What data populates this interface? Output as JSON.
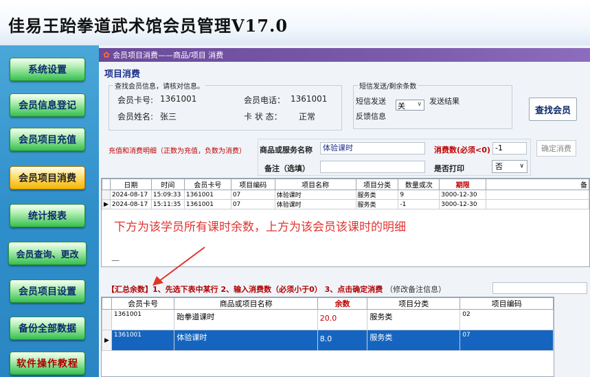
{
  "app_title": "佳易王跆拳道武术馆会员管理V17.0",
  "sidebar": {
    "items": [
      {
        "label": "系统设置"
      },
      {
        "label": "会员信息登记"
      },
      {
        "label": "会员项目充值"
      },
      {
        "label": "会员项目消费",
        "active": true
      },
      {
        "label": "统计报表"
      },
      {
        "label": "会员查询、更改"
      },
      {
        "label": "会员项目设置"
      },
      {
        "label": "备份全部数据"
      },
      {
        "label": "软件操作教程"
      }
    ]
  },
  "window": {
    "title": "会员项目消费——商品/项目 消费",
    "section_title": "项目消费"
  },
  "member_box": {
    "legend": "查找会员信息，请核对信息。",
    "card_no_label": "会员卡号:",
    "card_no": "1361001",
    "phone_label": "会员电话：",
    "phone": "1361001",
    "name_label": "会员姓名:",
    "name": "张三",
    "status_label": "卡  状  态：",
    "status": "正常"
  },
  "sms_box": {
    "legend": "短信发送/剩余条数",
    "send_label": "短信发送",
    "send_value": "关",
    "result_label": "发送结果",
    "feedback_label": "反馈信息"
  },
  "find_button": "查找会员",
  "consume": {
    "hint": "充值和消费明细（正数为充值，负数为消费）",
    "item_label": "商品或服务名称",
    "item_value": "体验课时",
    "amount_label": "消费数(必须<0)",
    "amount_value": "-1",
    "confirm_button": "确定消费",
    "note_label": "备注（选填）",
    "note_value": "",
    "print_label": "是否打印",
    "print_value": "否"
  },
  "top_table": {
    "headers": [
      "日期",
      "时间",
      "会员卡号",
      "项目编码",
      "项目名称",
      "项目分类",
      "数量或次",
      "期限",
      "备"
    ],
    "rows": [
      [
        "2024-08-17",
        "15:09:33",
        "1361001",
        "07",
        "体验课时",
        "服务类",
        "9",
        "3000-12-30",
        ""
      ],
      [
        "2024-08-17",
        "15:11:35",
        "1361001",
        "07",
        "体验课时",
        "服务类",
        "-1",
        "3000-12-30",
        ""
      ]
    ],
    "scroll_marker": "—"
  },
  "annotation": "下方为该学员所有课时余数，上方为该会员该课时的明细",
  "summary": {
    "text": "【汇总余数】1、先选下表中某行 2、输入消费数（必须小于0） 3、点击确定消费",
    "note": "（修改备注信息）"
  },
  "bottom_table": {
    "headers": [
      "会员卡号",
      "商品或项目名称",
      "余数",
      "项目分类",
      "项目编码"
    ],
    "rows": [
      [
        "1361001",
        "跆拳道课时",
        "20.0",
        "服务类",
        "02"
      ],
      [
        "1361001",
        "体验课时",
        "8.0",
        "服务类",
        "07"
      ]
    ],
    "selected_row": 1
  },
  "colors": {
    "title_bar": "#7b5aab",
    "accent_red": "#c00000",
    "selection": "#1565c0",
    "nav_green": "#35c04f",
    "nav_active": "#f4b400"
  }
}
